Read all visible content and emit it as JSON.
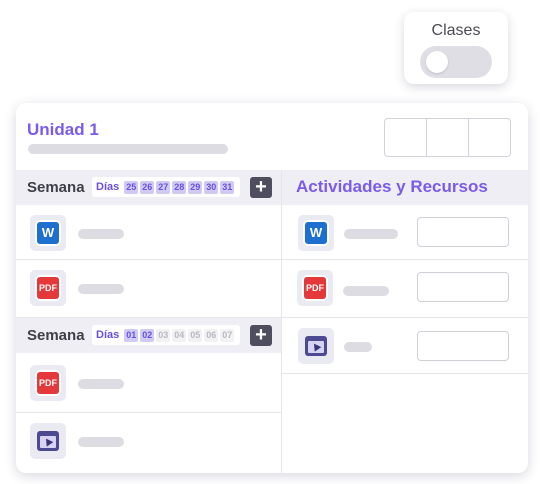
{
  "toggle": {
    "label": "Clases",
    "on": false
  },
  "unit": {
    "title": "Unidad 1"
  },
  "weeks": [
    {
      "label": "Semana",
      "days_label": "Días",
      "days": [
        {
          "d": "25",
          "active": true
        },
        {
          "d": "26",
          "active": true
        },
        {
          "d": "27",
          "active": true
        },
        {
          "d": "28",
          "active": true
        },
        {
          "d": "29",
          "active": true
        },
        {
          "d": "30",
          "active": true
        },
        {
          "d": "31",
          "active": true
        }
      ],
      "add_label": "+",
      "items": [
        {
          "icon": "word-icon",
          "tile": "W"
        },
        {
          "icon": "pdf-icon",
          "tile": "PDF"
        }
      ]
    },
    {
      "label": "Semana",
      "days_label": "Días",
      "days": [
        {
          "d": "01",
          "active": true
        },
        {
          "d": "02",
          "active": true
        },
        {
          "d": "03",
          "active": false
        },
        {
          "d": "04",
          "active": false
        },
        {
          "d": "05",
          "active": false
        },
        {
          "d": "06",
          "active": false
        },
        {
          "d": "07",
          "active": false
        }
      ],
      "add_label": "+",
      "items": [
        {
          "icon": "pdf-icon",
          "tile": "PDF"
        },
        {
          "icon": "screen-icon",
          "tile": ""
        }
      ]
    }
  ],
  "resources": {
    "title": "Actividades y Recursos",
    "items": [
      {
        "icon": "word-icon",
        "tile": "W"
      },
      {
        "icon": "pdf-icon",
        "tile": "PDF"
      },
      {
        "icon": "screen-icon",
        "tile": ""
      }
    ]
  },
  "colors": {
    "accent": "#7b5ce8",
    "header_bg": "#efeef5",
    "word": "#1d6fd0",
    "pdf": "#e4393a",
    "screen": "#4e4a92"
  }
}
